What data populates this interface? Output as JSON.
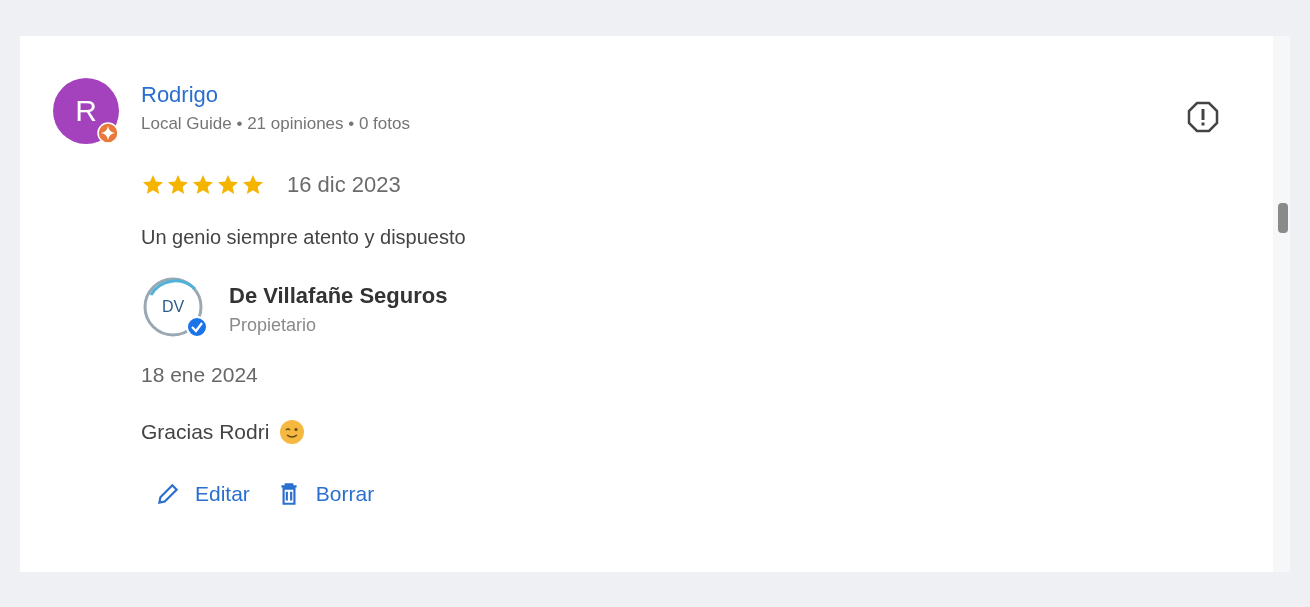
{
  "review": {
    "avatar_letter": "R",
    "name": "Rodrigo",
    "meta": "Local Guide • 21 opiniones • 0 fotos",
    "stars": 5,
    "date": "16 dic 2023",
    "text": "Un genio siempre atento y dispuesto"
  },
  "reply": {
    "logo_text": "DV",
    "owner": "De Villafañe Seguros",
    "role": "Propietario",
    "date": "18 ene 2024",
    "text": "Gracias Rodri"
  },
  "actions": [
    {
      "kind": "edit",
      "label": "Editar"
    },
    {
      "kind": "delete",
      "label": "Borrar"
    }
  ]
}
